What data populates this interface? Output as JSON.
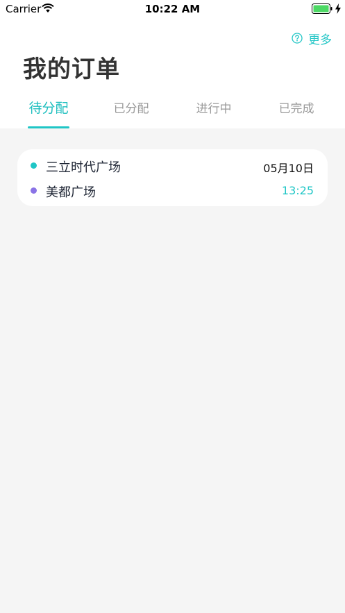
{
  "status_bar": {
    "carrier": "Carrier",
    "time": "10:22 AM"
  },
  "header": {
    "more_label": "更多",
    "title": "我的订单"
  },
  "tabs": [
    {
      "label": "待分配",
      "active": true
    },
    {
      "label": "已分配",
      "active": false
    },
    {
      "label": "进行中",
      "active": false
    },
    {
      "label": "已完成",
      "active": false
    }
  ],
  "orders": [
    {
      "start": "三立时代广场",
      "end": "美都广场",
      "date": "05月10日",
      "time": "13:25"
    }
  ],
  "colors": {
    "accent": "#1fc6c6",
    "end_dot": "#8a73e6",
    "background": "#f5f5f5"
  },
  "icons": [
    "wifi-icon",
    "battery-icon",
    "charging-bolt-icon",
    "help-circle-icon"
  ]
}
